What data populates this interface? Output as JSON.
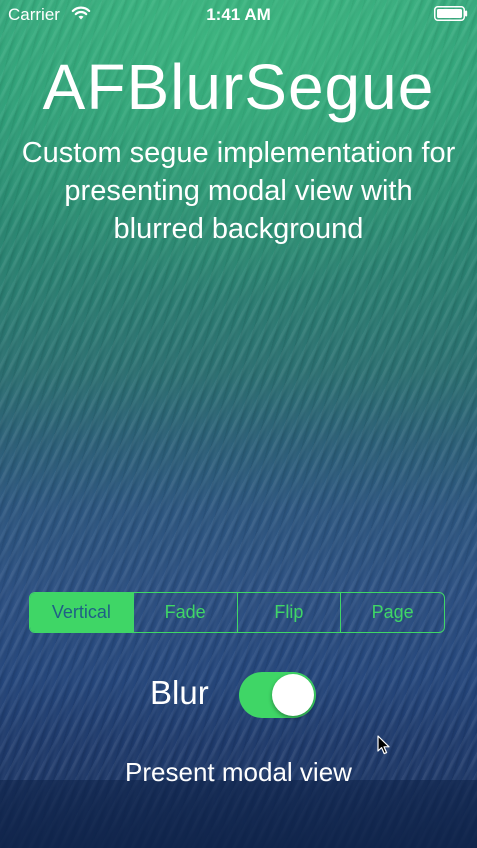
{
  "status_bar": {
    "carrier": "Carrier",
    "time": "1:41 AM"
  },
  "header": {
    "title": "AFBlurSegue",
    "subtitle": "Custom segue implementation for presenting modal view with blurred background"
  },
  "segmented_control": {
    "options": [
      "Vertical",
      "Fade",
      "Flip",
      "Page"
    ],
    "selected": "Vertical"
  },
  "blur_toggle": {
    "label": "Blur",
    "on": true
  },
  "present_button": {
    "label": "Present modal view"
  },
  "icons": [
    "wifi-icon",
    "battery-icon",
    "cursor-icon"
  ],
  "colors": {
    "accent": "#3fd666",
    "text": "#ffffff",
    "selected_segment_text": "#1f5f86"
  }
}
